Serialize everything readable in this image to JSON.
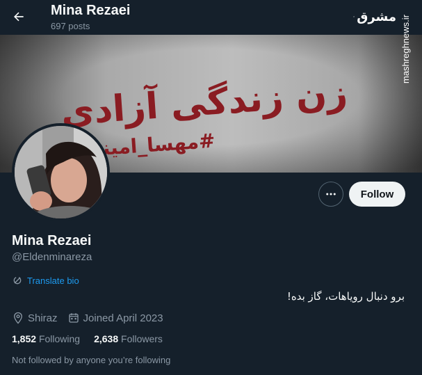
{
  "header": {
    "name": "Mina Rezaei",
    "posts": "697 posts"
  },
  "watermark": {
    "logo_text": "مشرق",
    "site": "mashreghnews.ir"
  },
  "banner": {
    "slogan": "زن زندگی آزادی",
    "hashtag": "#مهسا_امینی"
  },
  "actions": {
    "follow_label": "Follow",
    "more_label": "•••"
  },
  "profile": {
    "display_name": "Mina Rezaei",
    "handle": "@Eldenminareza",
    "translate_label": "Translate bio",
    "bio": "برو دنبال رویاهات، گاز بده!",
    "location": "Shiraz",
    "joined": "Joined April 2023",
    "following_count": "1,852",
    "following_label": "Following",
    "followers_count": "2,638",
    "followers_label": "Followers",
    "not_followed": "Not followed by anyone you’re following"
  },
  "colors": {
    "background": "#15202b",
    "accent": "#1d9bf0",
    "muted": "#8b98a5",
    "banner_text": "#8a1c22"
  }
}
